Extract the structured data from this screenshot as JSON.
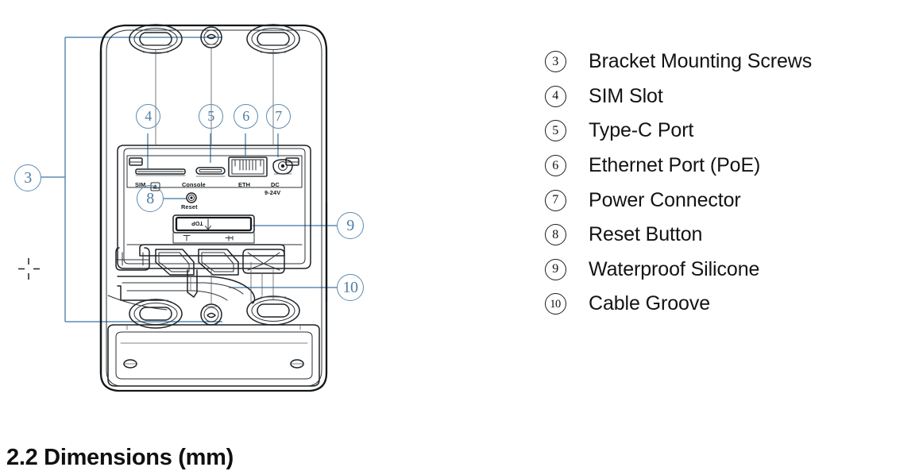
{
  "document": {
    "section_heading": "2.2 Dimensions (mm)"
  },
  "legend": {
    "items": [
      {
        "number": "3",
        "label": "Bracket Mounting Screws"
      },
      {
        "number": "4",
        "label": "SIM Slot"
      },
      {
        "number": "5",
        "label": "Type-C Port"
      },
      {
        "number": "6",
        "label": "Ethernet Port (PoE)"
      },
      {
        "number": "7",
        "label": "Power Connector"
      },
      {
        "number": "8",
        "label": "Reset Button"
      },
      {
        "number": "9",
        "label": "Waterproof Silicone"
      },
      {
        "number": "10",
        "label": "Cable Groove"
      }
    ]
  },
  "diagram": {
    "callouts": {
      "c3": "3",
      "c4": "4",
      "c5": "5",
      "c6": "6",
      "c7": "7",
      "c8": "8",
      "c9": "9",
      "c10": "10"
    },
    "silkscreen": {
      "sim": "SIM",
      "console": "Console",
      "eth": "ETH",
      "dc_line1": "DC",
      "dc_line2": "9-24V",
      "reset": "Reset",
      "top": "TOP"
    }
  },
  "colors": {
    "callout_blue": "#5d8bb0",
    "leader_blue": "#5b8cb4",
    "line_dark": "#1c1f22",
    "line_mid": "#3a3f44",
    "text_black": "#131313"
  }
}
